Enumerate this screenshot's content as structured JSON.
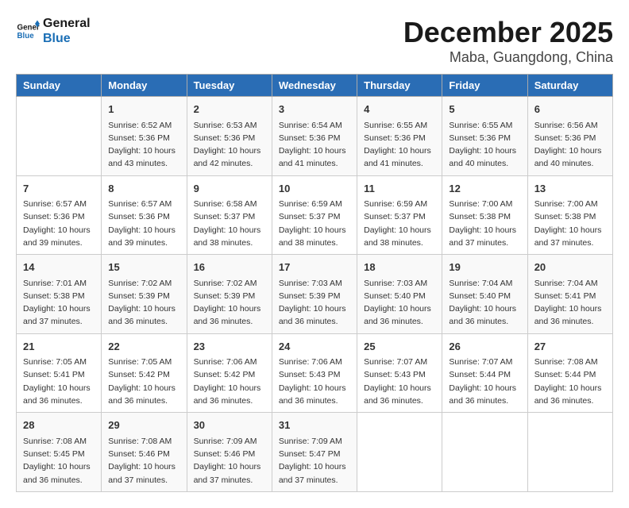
{
  "logo": {
    "line1": "General",
    "line2": "Blue"
  },
  "title": "December 2025",
  "location": "Maba, Guangdong, China",
  "weekdays": [
    "Sunday",
    "Monday",
    "Tuesday",
    "Wednesday",
    "Thursday",
    "Friday",
    "Saturday"
  ],
  "weeks": [
    [
      {
        "day": "",
        "sunrise": "",
        "sunset": "",
        "daylight": ""
      },
      {
        "day": "1",
        "sunrise": "Sunrise: 6:52 AM",
        "sunset": "Sunset: 5:36 PM",
        "daylight": "Daylight: 10 hours and 43 minutes."
      },
      {
        "day": "2",
        "sunrise": "Sunrise: 6:53 AM",
        "sunset": "Sunset: 5:36 PM",
        "daylight": "Daylight: 10 hours and 42 minutes."
      },
      {
        "day": "3",
        "sunrise": "Sunrise: 6:54 AM",
        "sunset": "Sunset: 5:36 PM",
        "daylight": "Daylight: 10 hours and 41 minutes."
      },
      {
        "day": "4",
        "sunrise": "Sunrise: 6:55 AM",
        "sunset": "Sunset: 5:36 PM",
        "daylight": "Daylight: 10 hours and 41 minutes."
      },
      {
        "day": "5",
        "sunrise": "Sunrise: 6:55 AM",
        "sunset": "Sunset: 5:36 PM",
        "daylight": "Daylight: 10 hours and 40 minutes."
      },
      {
        "day": "6",
        "sunrise": "Sunrise: 6:56 AM",
        "sunset": "Sunset: 5:36 PM",
        "daylight": "Daylight: 10 hours and 40 minutes."
      }
    ],
    [
      {
        "day": "7",
        "sunrise": "Sunrise: 6:57 AM",
        "sunset": "Sunset: 5:36 PM",
        "daylight": "Daylight: 10 hours and 39 minutes."
      },
      {
        "day": "8",
        "sunrise": "Sunrise: 6:57 AM",
        "sunset": "Sunset: 5:36 PM",
        "daylight": "Daylight: 10 hours and 39 minutes."
      },
      {
        "day": "9",
        "sunrise": "Sunrise: 6:58 AM",
        "sunset": "Sunset: 5:37 PM",
        "daylight": "Daylight: 10 hours and 38 minutes."
      },
      {
        "day": "10",
        "sunrise": "Sunrise: 6:59 AM",
        "sunset": "Sunset: 5:37 PM",
        "daylight": "Daylight: 10 hours and 38 minutes."
      },
      {
        "day": "11",
        "sunrise": "Sunrise: 6:59 AM",
        "sunset": "Sunset: 5:37 PM",
        "daylight": "Daylight: 10 hours and 38 minutes."
      },
      {
        "day": "12",
        "sunrise": "Sunrise: 7:00 AM",
        "sunset": "Sunset: 5:38 PM",
        "daylight": "Daylight: 10 hours and 37 minutes."
      },
      {
        "day": "13",
        "sunrise": "Sunrise: 7:00 AM",
        "sunset": "Sunset: 5:38 PM",
        "daylight": "Daylight: 10 hours and 37 minutes."
      }
    ],
    [
      {
        "day": "14",
        "sunrise": "Sunrise: 7:01 AM",
        "sunset": "Sunset: 5:38 PM",
        "daylight": "Daylight: 10 hours and 37 minutes."
      },
      {
        "day": "15",
        "sunrise": "Sunrise: 7:02 AM",
        "sunset": "Sunset: 5:39 PM",
        "daylight": "Daylight: 10 hours and 36 minutes."
      },
      {
        "day": "16",
        "sunrise": "Sunrise: 7:02 AM",
        "sunset": "Sunset: 5:39 PM",
        "daylight": "Daylight: 10 hours and 36 minutes."
      },
      {
        "day": "17",
        "sunrise": "Sunrise: 7:03 AM",
        "sunset": "Sunset: 5:39 PM",
        "daylight": "Daylight: 10 hours and 36 minutes."
      },
      {
        "day": "18",
        "sunrise": "Sunrise: 7:03 AM",
        "sunset": "Sunset: 5:40 PM",
        "daylight": "Daylight: 10 hours and 36 minutes."
      },
      {
        "day": "19",
        "sunrise": "Sunrise: 7:04 AM",
        "sunset": "Sunset: 5:40 PM",
        "daylight": "Daylight: 10 hours and 36 minutes."
      },
      {
        "day": "20",
        "sunrise": "Sunrise: 7:04 AM",
        "sunset": "Sunset: 5:41 PM",
        "daylight": "Daylight: 10 hours and 36 minutes."
      }
    ],
    [
      {
        "day": "21",
        "sunrise": "Sunrise: 7:05 AM",
        "sunset": "Sunset: 5:41 PM",
        "daylight": "Daylight: 10 hours and 36 minutes."
      },
      {
        "day": "22",
        "sunrise": "Sunrise: 7:05 AM",
        "sunset": "Sunset: 5:42 PM",
        "daylight": "Daylight: 10 hours and 36 minutes."
      },
      {
        "day": "23",
        "sunrise": "Sunrise: 7:06 AM",
        "sunset": "Sunset: 5:42 PM",
        "daylight": "Daylight: 10 hours and 36 minutes."
      },
      {
        "day": "24",
        "sunrise": "Sunrise: 7:06 AM",
        "sunset": "Sunset: 5:43 PM",
        "daylight": "Daylight: 10 hours and 36 minutes."
      },
      {
        "day": "25",
        "sunrise": "Sunrise: 7:07 AM",
        "sunset": "Sunset: 5:43 PM",
        "daylight": "Daylight: 10 hours and 36 minutes."
      },
      {
        "day": "26",
        "sunrise": "Sunrise: 7:07 AM",
        "sunset": "Sunset: 5:44 PM",
        "daylight": "Daylight: 10 hours and 36 minutes."
      },
      {
        "day": "27",
        "sunrise": "Sunrise: 7:08 AM",
        "sunset": "Sunset: 5:44 PM",
        "daylight": "Daylight: 10 hours and 36 minutes."
      }
    ],
    [
      {
        "day": "28",
        "sunrise": "Sunrise: 7:08 AM",
        "sunset": "Sunset: 5:45 PM",
        "daylight": "Daylight: 10 hours and 36 minutes."
      },
      {
        "day": "29",
        "sunrise": "Sunrise: 7:08 AM",
        "sunset": "Sunset: 5:46 PM",
        "daylight": "Daylight: 10 hours and 37 minutes."
      },
      {
        "day": "30",
        "sunrise": "Sunrise: 7:09 AM",
        "sunset": "Sunset: 5:46 PM",
        "daylight": "Daylight: 10 hours and 37 minutes."
      },
      {
        "day": "31",
        "sunrise": "Sunrise: 7:09 AM",
        "sunset": "Sunset: 5:47 PM",
        "daylight": "Daylight: 10 hours and 37 minutes."
      },
      {
        "day": "",
        "sunrise": "",
        "sunset": "",
        "daylight": ""
      },
      {
        "day": "",
        "sunrise": "",
        "sunset": "",
        "daylight": ""
      },
      {
        "day": "",
        "sunrise": "",
        "sunset": "",
        "daylight": ""
      }
    ]
  ]
}
